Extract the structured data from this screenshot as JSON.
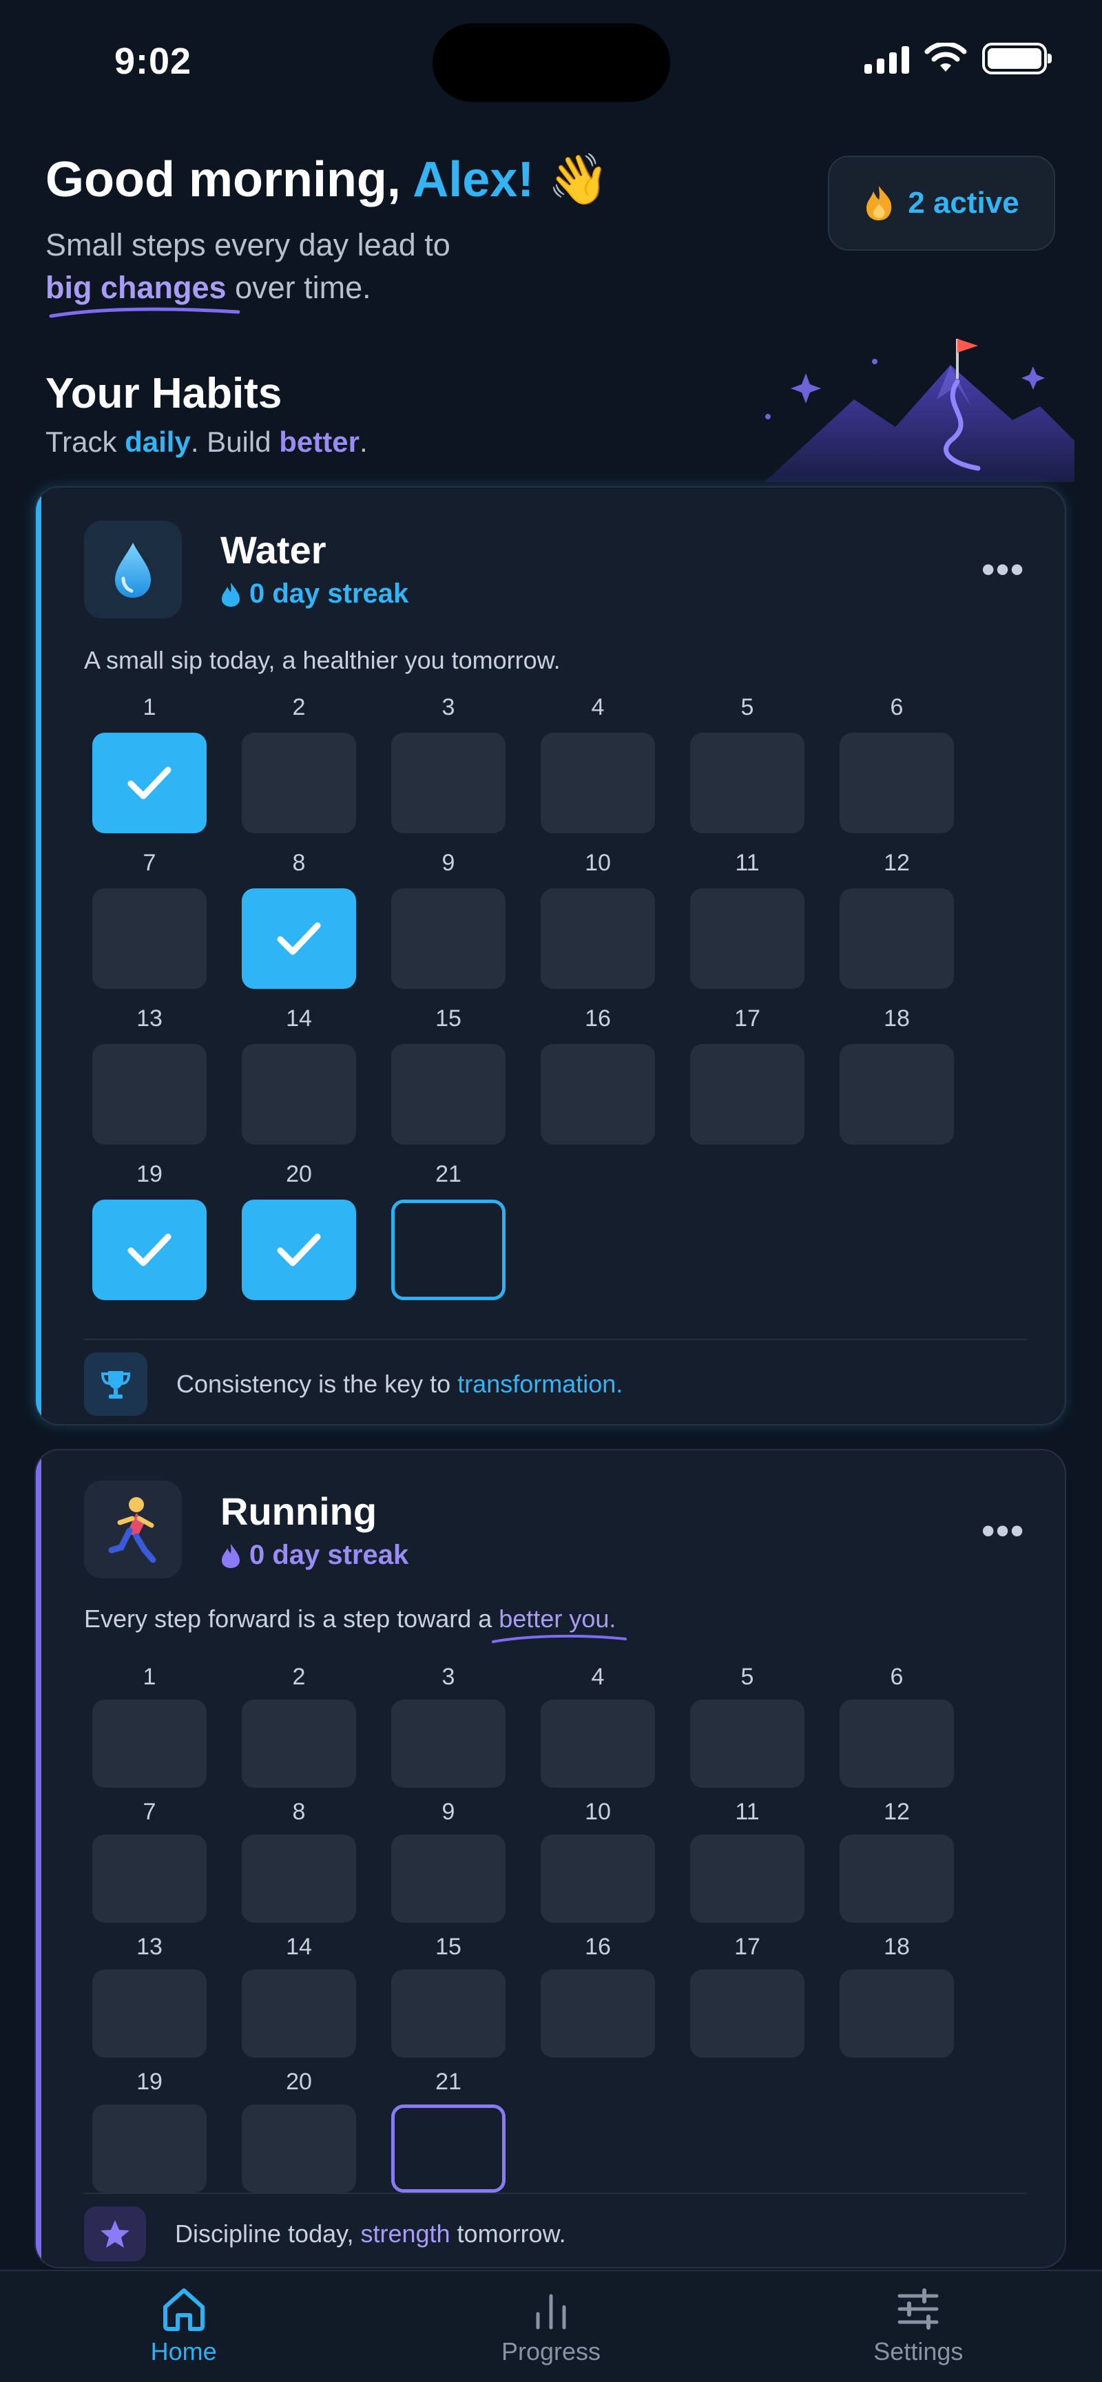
{
  "status_bar": {
    "time": "9:02"
  },
  "header": {
    "greeting_prefix": "Good morning, ",
    "user_name": "Alex!",
    "wave_emoji": "👋",
    "subtitle_line1": "Small steps every day lead to",
    "subtitle_highlight": "big changes",
    "subtitle_suffix": " over time.",
    "active_badge": "2 active",
    "active_icon": "fire-icon"
  },
  "section": {
    "title": "Your Habits",
    "sub_prefix": "Track ",
    "sub_word1": "daily",
    "sub_mid": ". Build ",
    "sub_word2": "better",
    "sub_suffix": "."
  },
  "habits": [
    {
      "name": "Water",
      "icon": "water-drop-icon",
      "streak": "0 day streak",
      "quote": "A small sip today, a healthier you tomorrow.",
      "accent": "#2fb0f2",
      "days": [
        "1",
        "2",
        "3",
        "4",
        "5",
        "6",
        "7",
        "8",
        "9",
        "10",
        "11",
        "12",
        "13",
        "14",
        "15",
        "16",
        "17",
        "18",
        "19",
        "20",
        "21"
      ],
      "completed": [
        1,
        8,
        19,
        20
      ],
      "today": 21,
      "footer_prefix": "Consistency is the key to ",
      "footer_highlight": "transformation",
      "footer_suffix": ".",
      "footer_icon": "trophy-icon"
    },
    {
      "name": "Running",
      "icon": "runner-icon",
      "streak": "0 day streak",
      "quote_prefix": "Every step forward is a step toward a ",
      "quote_highlight": "better you.",
      "accent": "#7f6cf0",
      "days": [
        "1",
        "2",
        "3",
        "4",
        "5",
        "6",
        "7",
        "8",
        "9",
        "10",
        "11",
        "12",
        "13",
        "14",
        "15",
        "16",
        "17",
        "18",
        "19",
        "20",
        "21"
      ],
      "completed": [],
      "today": 21,
      "footer_prefix": "Discipline today, ",
      "footer_highlight": "strength",
      "footer_suffix": " tomorrow.",
      "footer_icon": "star-icon"
    }
  ],
  "tabbar": {
    "items": [
      {
        "label": "Home",
        "icon": "home-icon",
        "active": true
      },
      {
        "label": "Progress",
        "icon": "bar-chart-icon",
        "active": false
      },
      {
        "label": "Settings",
        "icon": "sliders-icon",
        "active": false
      }
    ]
  }
}
